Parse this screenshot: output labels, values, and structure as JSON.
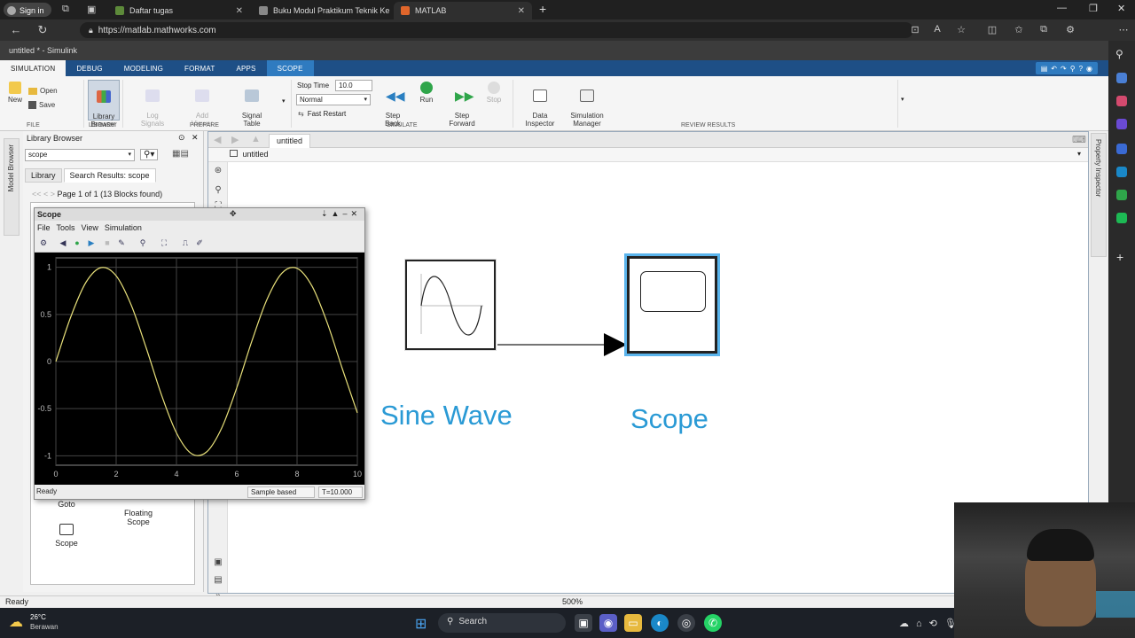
{
  "browser": {
    "signin": "Sign in",
    "tabs": [
      {
        "label": "Daftar tugas",
        "color": "#5d8a3a"
      },
      {
        "label": "Buku Modul Praktikum Teknik Ke",
        "color": "#888888"
      },
      {
        "label": "MATLAB",
        "color": "#e0662b"
      }
    ],
    "url": "https://matlab.mathworks.com"
  },
  "window": {
    "title": "untitled * - Simulink"
  },
  "ribbon_tabs": [
    "SIMULATION",
    "DEBUG",
    "MODELING",
    "FORMAT",
    "APPS",
    "SCOPE"
  ],
  "ribbon": {
    "file": {
      "new": "New",
      "open": "Open",
      "save": "Save",
      "group": "FILE"
    },
    "library": {
      "browser": "Library\nBrowser",
      "group": "LIBRARY"
    },
    "prepare": {
      "log_signals": "Log\nSignals",
      "add_viewer": "Add\nViewer",
      "signal_table": "Signal\nTable",
      "group": "PREPARE"
    },
    "simulate": {
      "stop_time_label": "Stop Time",
      "stop_time_value": "10.0",
      "mode": "Normal",
      "fast_restart": "Fast Restart",
      "step_back": "Step\nBack",
      "run": "Run",
      "step_forward": "Step\nForward",
      "stop": "Stop",
      "group": "SIMULATE"
    },
    "review": {
      "data_inspector": "Data\nInspector",
      "sim_manager": "Simulation\nManager",
      "group": "REVIEW RESULTS"
    }
  },
  "left_strip": "Model Browser",
  "right_strip": "Property Inspector",
  "library": {
    "title": "Library Browser",
    "search": "scope",
    "tabs": [
      "Library",
      "Search Results: scope"
    ],
    "page_info": "Page 1 of 1 (13 Blocks found)",
    "items": [
      "Goto",
      "Floating\nScope",
      "Scope"
    ]
  },
  "canvas": {
    "tab": "untitled",
    "breadcrumb": "untitled",
    "blocks": {
      "sine": "Sine Wave",
      "scope": "Scope"
    }
  },
  "status": {
    "left": "Ready",
    "zoom": "500%"
  },
  "scope_window": {
    "title": "Scope",
    "menu": [
      "File",
      "Tools",
      "View",
      "Simulation"
    ],
    "status_ready": "Ready",
    "sample_mode": "Sample based",
    "time": "T=10.000"
  },
  "chart_data": {
    "type": "line",
    "title": "",
    "xlabel": "",
    "ylabel": "",
    "xlim": [
      0,
      10
    ],
    "ylim": [
      -1.1,
      1.1
    ],
    "xticks": [
      "0",
      "2",
      "4",
      "6",
      "8",
      "10"
    ],
    "yticks": [
      "1",
      "0.5",
      "0",
      "-0.5",
      "-1"
    ],
    "grid": true,
    "series": [
      {
        "color": "#e8e07a",
        "x": [
          0,
          0.5,
          1,
          1.5,
          2,
          2.5,
          3,
          3.5,
          4,
          4.5,
          5,
          5.5,
          6,
          6.5,
          7,
          7.5,
          8,
          8.5,
          9,
          9.5,
          10
        ],
        "y": [
          0,
          0.479,
          0.841,
          0.997,
          0.909,
          0.598,
          0.141,
          -0.351,
          -0.757,
          -0.978,
          -0.959,
          -0.706,
          -0.279,
          0.215,
          0.657,
          0.938,
          0.989,
          0.798,
          0.412,
          -0.075,
          -0.544
        ]
      }
    ]
  },
  "taskbar": {
    "temp": "26°C",
    "weather": "Berawan",
    "search": "Search"
  }
}
